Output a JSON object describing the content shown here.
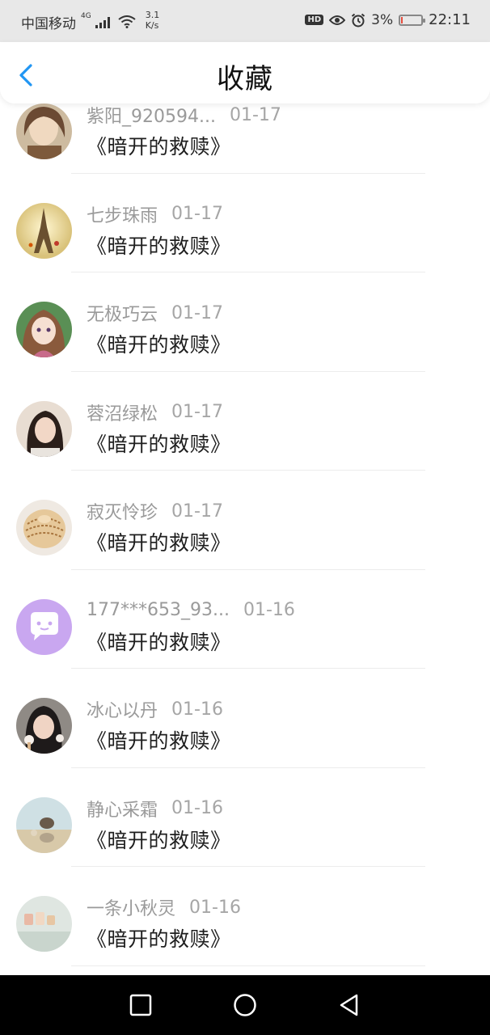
{
  "status": {
    "carrier": "中国移动",
    "network": "4G",
    "speed_top": "3.1",
    "speed_bottom": "K/s",
    "hd": "HD",
    "battery_pct": "3%",
    "battery_level": 0.03,
    "time": "22:11"
  },
  "header": {
    "title": "收藏"
  },
  "items": [
    {
      "user": "紫阳_920594...",
      "date": "01-17",
      "title": "《暗开的救赎》",
      "avatar": "avatar-anime-man"
    },
    {
      "user": "七步珠雨",
      "date": "01-17",
      "title": "《暗开的救赎》",
      "avatar": "avatar-eiffel-tower"
    },
    {
      "user": "无极巧云",
      "date": "01-17",
      "title": "《暗开的救赎》",
      "avatar": "avatar-anime-girl"
    },
    {
      "user": "蓉沼绿松",
      "date": "01-17",
      "title": "《暗开的救赎》",
      "avatar": "avatar-woman-photo"
    },
    {
      "user": "寂灭怜珍",
      "date": "01-17",
      "title": "《暗开的救赎》",
      "avatar": "avatar-seashell"
    },
    {
      "user": "177***653_93...",
      "date": "01-16",
      "title": "《暗开的救赎》",
      "avatar": "avatar-default-chat"
    },
    {
      "user": "冰心以丹",
      "date": "01-16",
      "title": "《暗开的救赎》",
      "avatar": "avatar-girl-icecream"
    },
    {
      "user": "静心采霜",
      "date": "01-16",
      "title": "《暗开的救赎》",
      "avatar": "avatar-cats-mirror"
    },
    {
      "user": "一条小秋灵",
      "date": "01-16",
      "title": "《暗开的救赎》",
      "avatar": "avatar-cups"
    }
  ],
  "colors": {
    "accent": "#2196f3",
    "battery_low": "#e74c3c",
    "chat_avatar": "#c9a7f0"
  }
}
